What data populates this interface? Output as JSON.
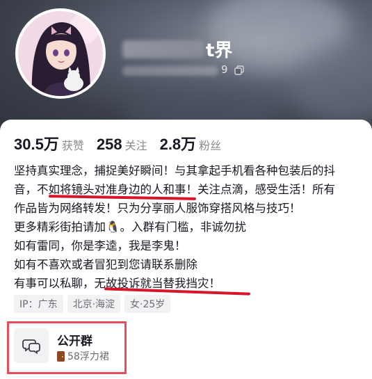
{
  "profile": {
    "name_visible_tail": "t界",
    "id_visible_tail": "9"
  },
  "stats": [
    {
      "value": "30.5万",
      "label": "获赞"
    },
    {
      "value": "258",
      "label": "关注"
    },
    {
      "value": "2.8万",
      "label": "粉丝"
    }
  ],
  "bio": {
    "lines": [
      "坚持真实理念，捕捉美好瞬间！与其拿起手机看各种包装后的抖",
      "音，不如将镜头对准身边的人和事！关注点滴，感受生活！所有",
      "作品皆为网络转发！只为分享丽人服饰穿搭风格与技巧！",
      "更多精彩街拍请加🐧。入群有门槛，非诚勿扰",
      "如有雷同，你是李逵，我是李鬼！",
      "如有不喜欢或者冒犯到您请联系删除",
      "有事可以私聊，无故投诉就当替我挡灾！"
    ]
  },
  "tags": [
    "IP：广东",
    "北京·海淀",
    "女·25岁"
  ],
  "group": {
    "title": "公开群",
    "subtitle": "58浮力裙"
  },
  "colors": {
    "underline": "#d8142b",
    "highlight_box": "#e84d5b"
  }
}
